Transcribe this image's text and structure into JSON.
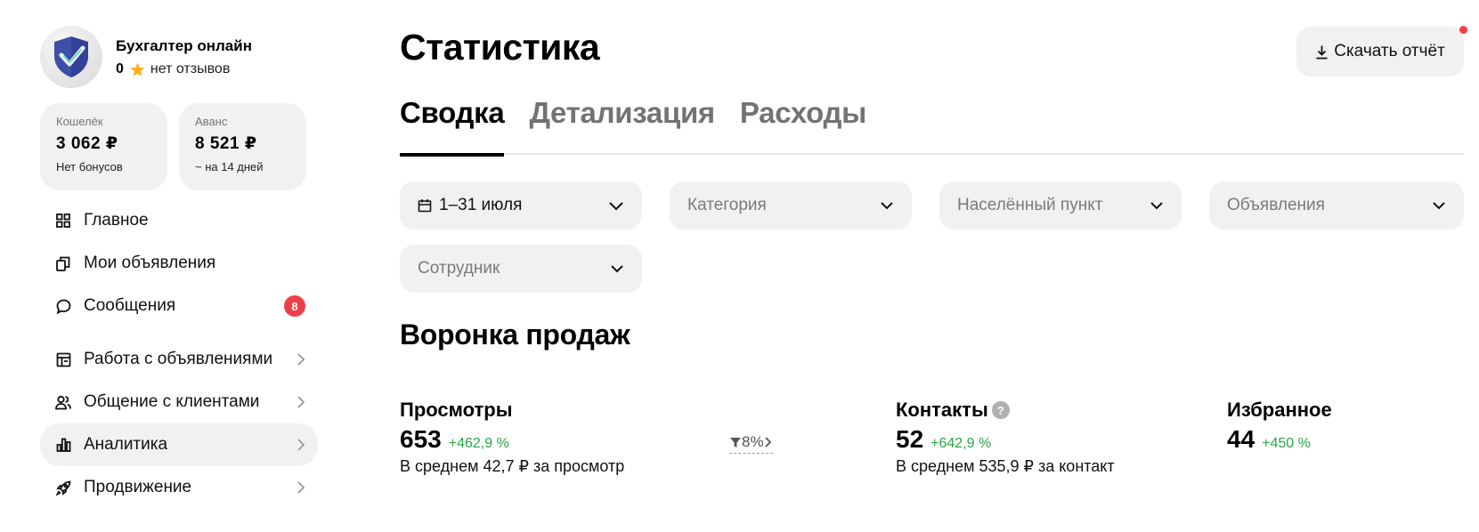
{
  "sidebar": {
    "profile": {
      "name": "Бухгалтер онлайн",
      "rating": "0",
      "reviews": "нет отзывов"
    },
    "wallet": {
      "label": "Кошелёк",
      "amount": "3 062 ₽",
      "note": "Нет бонусов"
    },
    "advance": {
      "label": "Аванс",
      "amount": "8 521 ₽",
      "note": "~ на 14 дней"
    },
    "nav_primary": [
      {
        "label": "Главное",
        "icon": "grid-icon"
      },
      {
        "label": "Мои объявления",
        "icon": "copy-icon"
      },
      {
        "label": "Сообщения",
        "icon": "chat-icon",
        "badge": "8"
      }
    ],
    "nav_secondary": [
      {
        "label": "Работа с объявлениями",
        "icon": "layout-icon"
      },
      {
        "label": "Общение с клиентами",
        "icon": "users-icon"
      },
      {
        "label": "Аналитика",
        "icon": "bar-chart-icon",
        "active": true
      },
      {
        "label": "Продвижение",
        "icon": "rocket-icon"
      }
    ]
  },
  "header": {
    "title": "Статистика",
    "download_label": "Скачать отчёт"
  },
  "tabs": [
    {
      "label": "Сводка",
      "active": true
    },
    {
      "label": "Детализация"
    },
    {
      "label": "Расходы"
    }
  ],
  "filters": {
    "period": "1–31 июля",
    "category": "Категория",
    "locality": "Населённый пункт",
    "listings": "Объявления",
    "employee": "Сотрудник"
  },
  "funnel": {
    "title": "Воронка продаж",
    "views": {
      "title": "Просмотры",
      "value": "653",
      "delta": "+462,9 %",
      "desc": "В среднем 42,7 ₽ за просмотр"
    },
    "conversion": "8%",
    "contacts": {
      "title": "Контакты",
      "value": "52",
      "delta": "+642,9 %",
      "desc": "В среднем 535,9 ₽ за контакт"
    },
    "favorites": {
      "title": "Избранное",
      "value": "44",
      "delta": "+450 %"
    }
  },
  "colors": {
    "accent_red": "#ee3f48",
    "positive_green": "#2aa544",
    "surface": "#f2f1f0"
  }
}
